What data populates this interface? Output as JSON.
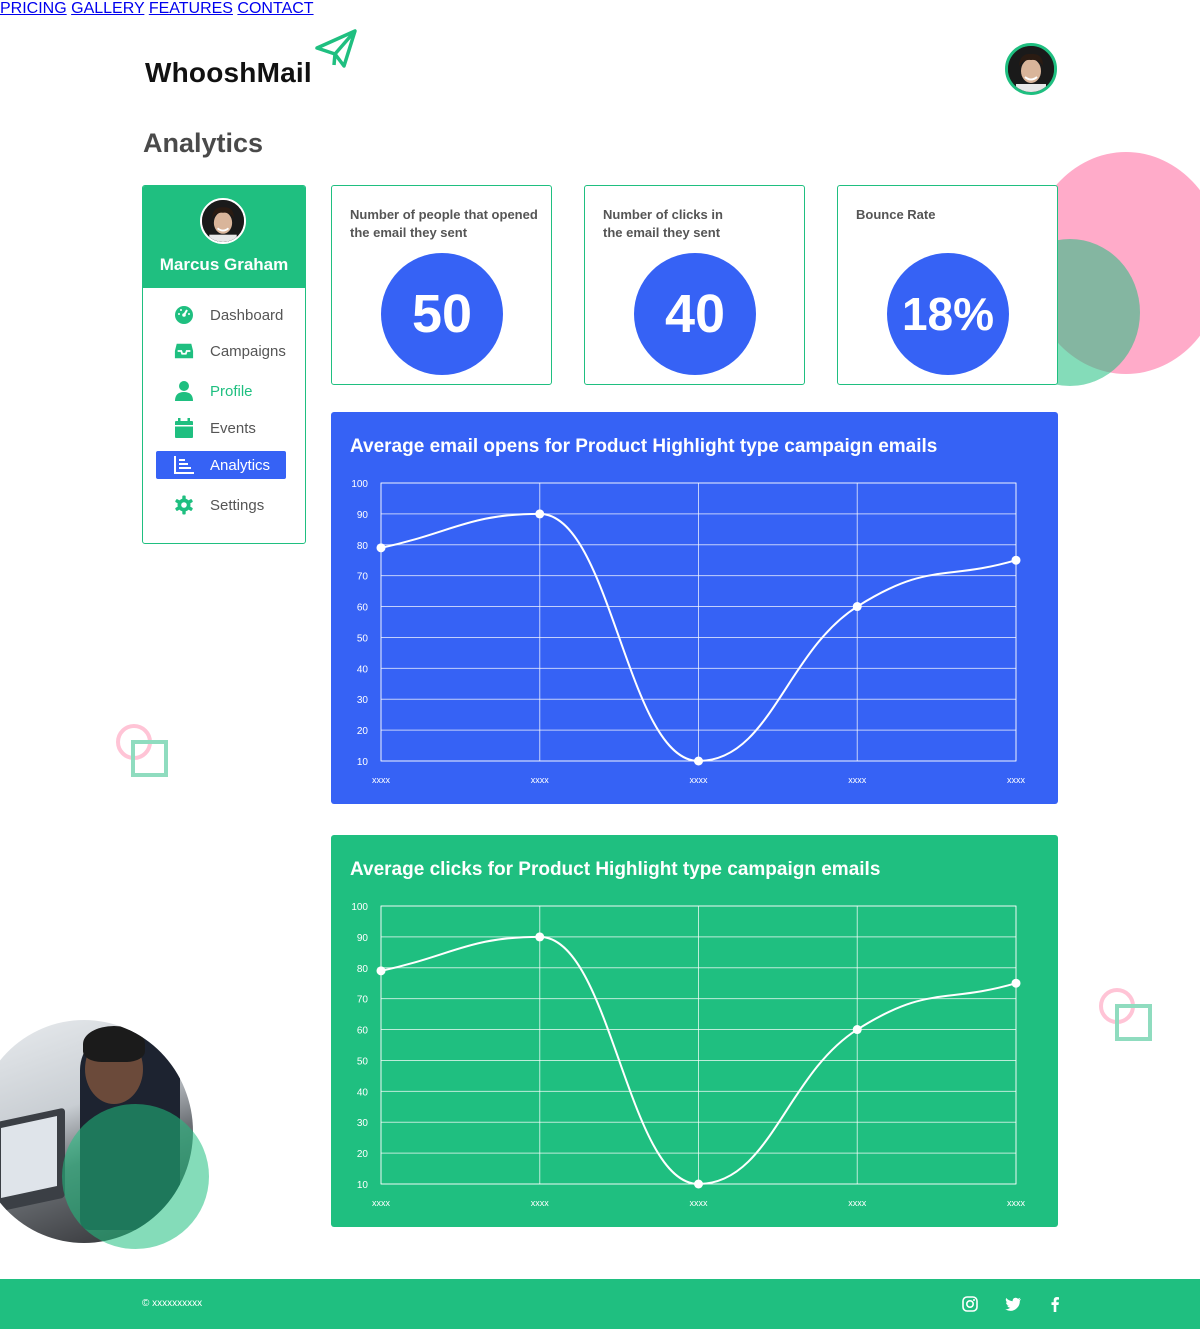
{
  "brand": {
    "name": "WhooshMail"
  },
  "nav": {
    "items": [
      "PRICING",
      "GALLERY",
      "FEATURES",
      "CONTACT"
    ]
  },
  "page": {
    "title": "Analytics"
  },
  "user": {
    "name": "Marcus Graham"
  },
  "sidebar": {
    "items": [
      {
        "label": "Dashboard",
        "icon": "dashboard-icon"
      },
      {
        "label": "Campaigns",
        "icon": "inbox-icon"
      },
      {
        "label": "Profile",
        "icon": "user-icon"
      },
      {
        "label": "Events",
        "icon": "calendar-icon"
      },
      {
        "label": "Analytics",
        "icon": "chart-icon"
      },
      {
        "label": "Settings",
        "icon": "gear-icon"
      }
    ]
  },
  "stats": [
    {
      "caption": "Number of people that opened the email they sent",
      "value": "50"
    },
    {
      "caption": "Number of clicks in the email they sent",
      "value": "40"
    },
    {
      "caption": "Bounce Rate",
      "value": "18%"
    }
  ],
  "chart_data": [
    {
      "type": "line",
      "title": "Average email opens for Product Highlight type campaign emails",
      "categories": [
        "xxxx",
        "xxxx",
        "xxxx",
        "xxxx",
        "xxxx"
      ],
      "values": [
        79,
        90,
        10,
        60,
        75
      ],
      "yticks": [
        10,
        20,
        30,
        40,
        50,
        60,
        70,
        80,
        90,
        100
      ],
      "ylim": [
        10,
        100
      ],
      "grid": true,
      "background": "#3662f5"
    },
    {
      "type": "line",
      "title": "Average clicks for Product Highlight type campaign emails",
      "categories": [
        "xxxx",
        "xxxx",
        "xxxx",
        "xxxx",
        "xxxx"
      ],
      "values": [
        79,
        90,
        10,
        60,
        75
      ],
      "yticks": [
        10,
        20,
        30,
        40,
        50,
        60,
        70,
        80,
        90,
        100
      ],
      "ylim": [
        10,
        100
      ],
      "grid": true,
      "background": "#1fbf80"
    }
  ],
  "footer": {
    "copyright": "© xxxxxxxxxx",
    "social": [
      "instagram-icon",
      "twitter-icon",
      "facebook-icon"
    ]
  },
  "colors": {
    "primary_green": "#1fbf80",
    "primary_blue": "#3662f5",
    "pink": "#ffabc9"
  }
}
